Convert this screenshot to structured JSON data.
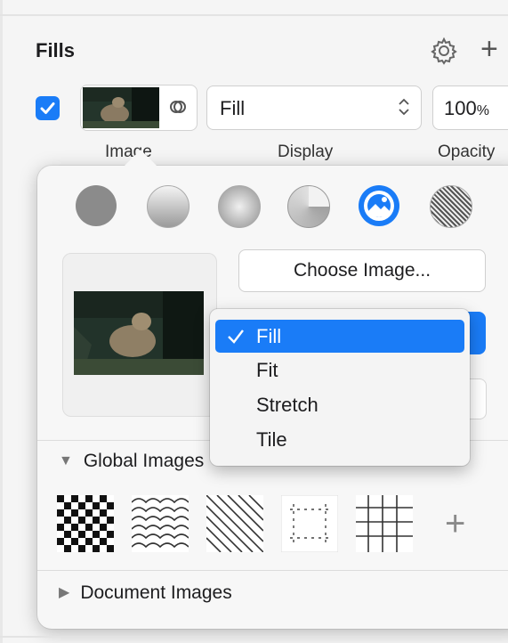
{
  "fills": {
    "title": "Fills",
    "display_value": "Fill",
    "opacity_value": "100",
    "opacity_unit": "%",
    "labels": {
      "image": "Image",
      "display": "Display",
      "opacity": "Opacity"
    },
    "enabled": true
  },
  "popover": {
    "fill_types": [
      "solid-fill-icon",
      "linear-gradient-icon",
      "radial-gradient-icon",
      "angular-gradient-icon",
      "image-fill-icon",
      "noise-fill-icon"
    ],
    "selected_fill_type": "image-fill-icon",
    "choose_image_label": "Choose Image...",
    "global_images_label": "Global Images",
    "document_images_label": "Document Images",
    "patterns": [
      "checkerboard-pattern",
      "waves-pattern",
      "diagonal-lines-pattern",
      "dotted-grid-pattern",
      "grid-pattern"
    ],
    "add_pattern_label": "+"
  },
  "display_menu": {
    "items": [
      "Fill",
      "Fit",
      "Stretch",
      "Tile"
    ],
    "selected": "Fill"
  },
  "colors": {
    "accent": "#1a7cf7"
  }
}
